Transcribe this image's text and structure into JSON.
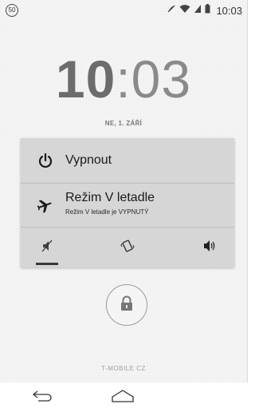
{
  "status_bar": {
    "notification_badge": "50",
    "icons": [
      "mute-icon",
      "wifi-icon",
      "signal-icon",
      "battery-icon"
    ],
    "time": "10:03"
  },
  "lockscreen": {
    "clock": {
      "hours": "10",
      "separator": ":",
      "minutes": "03"
    },
    "date": "NE, 1. ZÁŘÍ",
    "carrier": "T-MOBILE CZ",
    "lock_icon": "lock-icon"
  },
  "power_menu": {
    "items": [
      {
        "icon": "power-icon",
        "label": "Vypnout"
      },
      {
        "icon": "airplane-icon",
        "label": "Režim V letadle",
        "sublabel": "Režim V letadle je VYPNUTÝ"
      }
    ],
    "sound_modes": [
      {
        "icon": "silent-icon",
        "selected": true
      },
      {
        "icon": "vibrate-icon",
        "selected": false
      },
      {
        "icon": "sound-on-icon",
        "selected": false
      }
    ]
  },
  "navigation": {
    "buttons": [
      "back-icon",
      "home-icon"
    ]
  },
  "colors": {
    "background": "#f4f4f4",
    "menu_bg": "#d6d6d6",
    "text_dark": "#1a1a1a",
    "clock": "#777777"
  }
}
